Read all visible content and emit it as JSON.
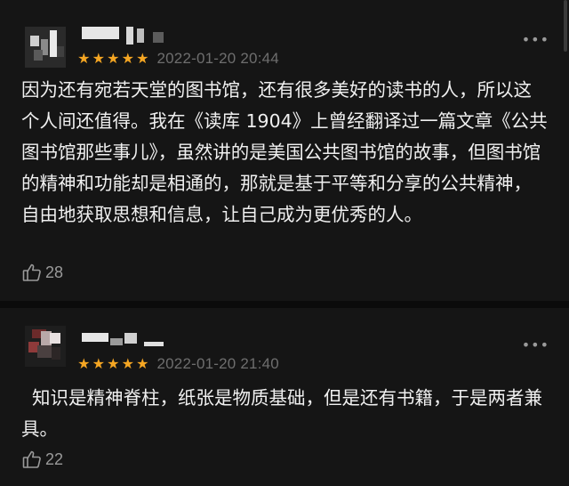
{
  "comments": [
    {
      "date": "2022-01-20 20:44",
      "text": "因为还有宛若天堂的图书馆，还有很多美好的读书的人，所以这个人间还值得。我在《读库 1904》上曾经翻译过一篇文章《公共图书馆那些事儿》，虽然讲的是美国公共图书馆的故事，但图书馆的精神和功能却是相通的，那就是基于平等和分享的公共精神，自由地获取思想和信息，让自己成为更优秀的人。",
      "likes": "28",
      "rating": 5
    },
    {
      "date": "2022-01-20 21:40",
      "text": "知识是精神脊柱，纸张是物质基础，但是还有书籍，于是两者兼具。",
      "likes": "22",
      "rating": 5
    }
  ],
  "icons": {
    "star": "star-icon",
    "more": "more-icon",
    "like": "thumbs-up-icon"
  },
  "colors": {
    "background": "#151515",
    "star": "#f5a623",
    "meta": "#6e6e6e"
  }
}
